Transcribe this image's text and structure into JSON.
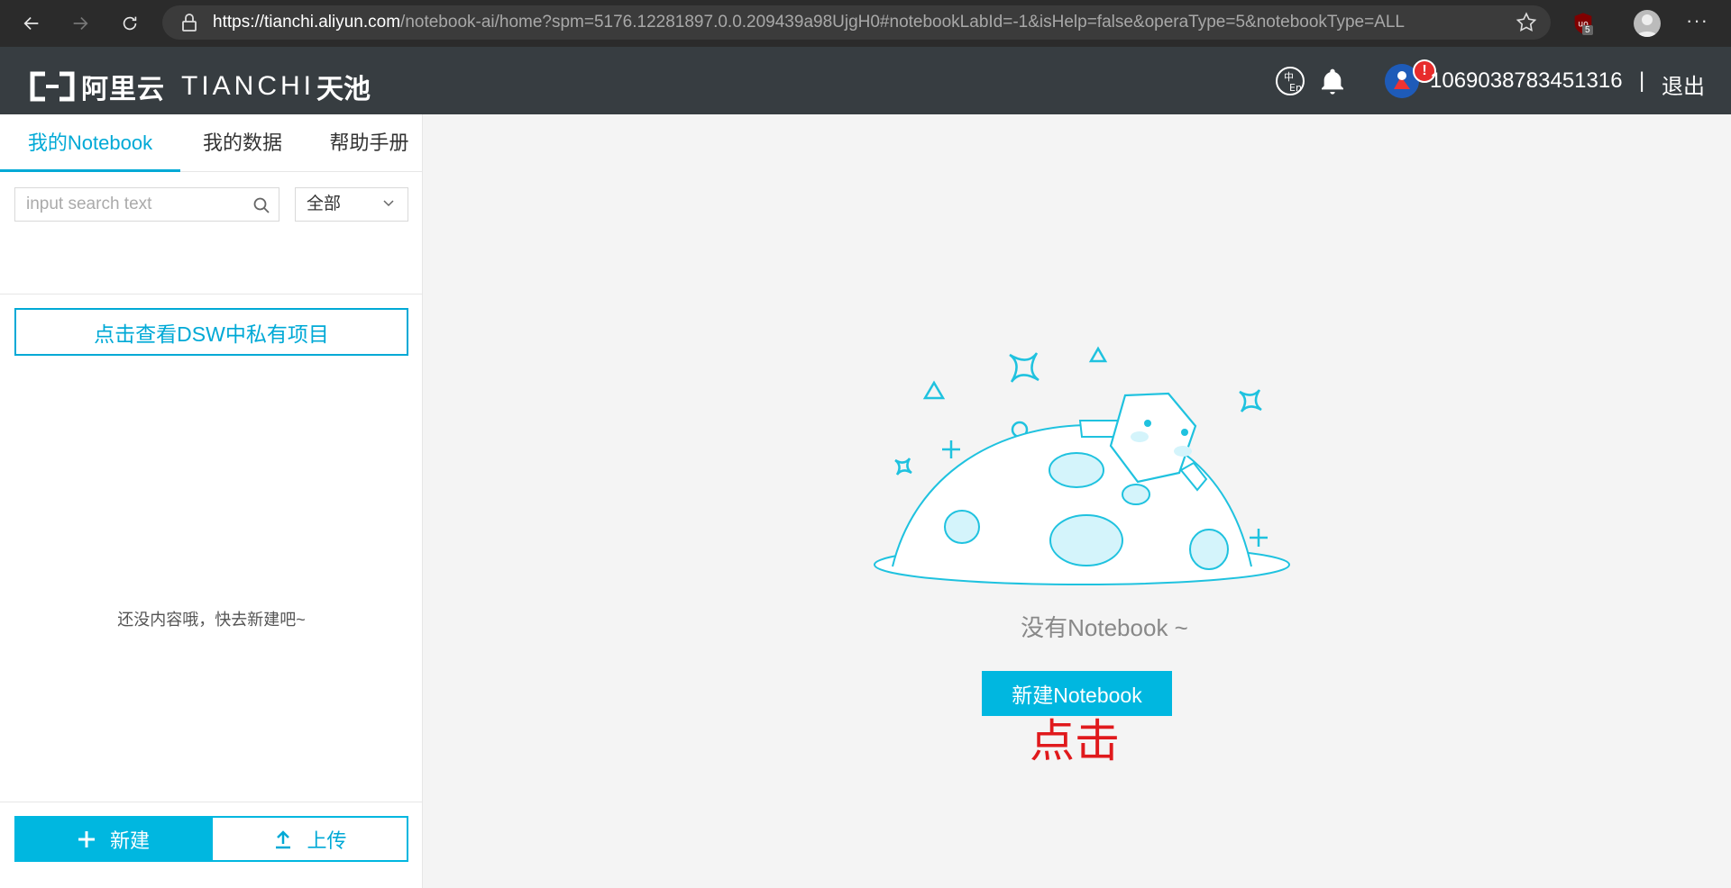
{
  "browser": {
    "url_host": "https://tianchi.aliyun.com",
    "url_path": "/notebook-ai/home?spm=5176.12281897.0.0.209439a98UjgH0#notebookLabId=-1&isHelp=false&operaType=5&notebookType=ALL",
    "extension_badge": "5"
  },
  "header": {
    "logo_cn": "阿里云",
    "logo_en": "TIANCHI",
    "logo_cn2": "天池",
    "alert_badge": "!",
    "user_id": "1069038783451316",
    "separator": "|",
    "logout_label": "退出"
  },
  "sidebar": {
    "tabs": [
      {
        "label": "我的Notebook",
        "active": true
      },
      {
        "label": "我的数据",
        "active": false
      },
      {
        "label": "帮助手册",
        "active": false
      }
    ],
    "search": {
      "placeholder": "input search text",
      "value": ""
    },
    "filter": {
      "selected": "全部"
    },
    "dsw_button_label": "点击查看DSW中私有项目",
    "empty_text": "还没内容哦，快去新建吧~",
    "new_label": "新建",
    "upload_label": "上传"
  },
  "main": {
    "empty_title": "没有Notebook ~",
    "new_notebook_label": "新建Notebook",
    "click_hint": "点击"
  },
  "colors": {
    "accent": "#00b7e0",
    "header_bg": "#373d41",
    "browser_bg": "#2b2b2b",
    "hint_red": "#e0191c"
  }
}
